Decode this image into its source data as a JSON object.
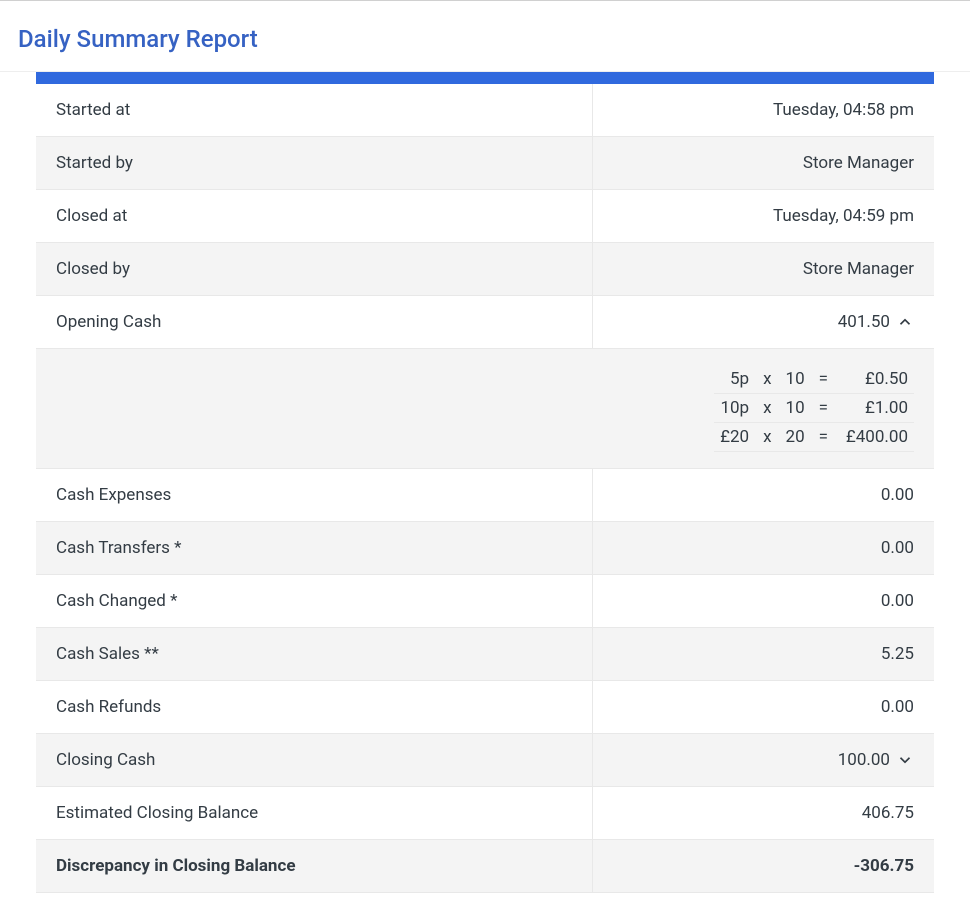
{
  "title": "Daily Summary Report",
  "rows": {
    "started_at": {
      "label": "Started at",
      "value": "Tuesday, 04:58 pm"
    },
    "started_by": {
      "label": "Started by",
      "value": "Store Manager"
    },
    "closed_at": {
      "label": "Closed at",
      "value": "Tuesday, 04:59 pm"
    },
    "closed_by": {
      "label": "Closed by",
      "value": "Store Manager"
    },
    "opening_cash": {
      "label": "Opening Cash",
      "value": "401.50"
    },
    "cash_expenses": {
      "label": "Cash Expenses",
      "value": "0.00"
    },
    "cash_transfers": {
      "label": "Cash Transfers *",
      "value": "0.00"
    },
    "cash_changed": {
      "label": "Cash Changed *",
      "value": "0.00"
    },
    "cash_sales": {
      "label": "Cash Sales **",
      "value": "5.25"
    },
    "cash_refunds": {
      "label": "Cash Refunds",
      "value": "0.00"
    },
    "closing_cash": {
      "label": "Closing Cash",
      "value": "100.00"
    },
    "est_closing": {
      "label": "Estimated Closing Balance",
      "value": "406.75"
    },
    "discrepancy": {
      "label": "Discrepancy in Closing Balance",
      "value": "-306.75"
    }
  },
  "opening_cash_breakdown": [
    {
      "denom": "5p",
      "qty": "10",
      "amount": "£0.50"
    },
    {
      "denom": "10p",
      "qty": "10",
      "amount": "£1.00"
    },
    {
      "denom": "£20",
      "qty": "20",
      "amount": "£400.00"
    }
  ],
  "ops": {
    "x": "x",
    "eq": "="
  }
}
